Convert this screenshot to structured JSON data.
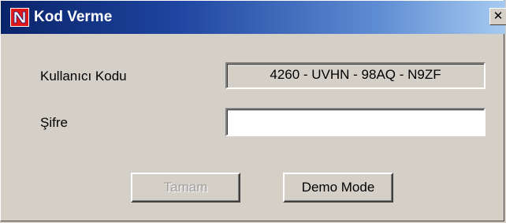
{
  "window": {
    "title": "Kod Verme",
    "close_label": "✕"
  },
  "form": {
    "user_code_label": "Kullanıcı Kodu",
    "user_code_value": "4260 - UVHN - 98AQ - N9ZF",
    "password_label": "Şifre",
    "password_value": ""
  },
  "buttons": {
    "ok_label": "Tamam",
    "ok_enabled": false,
    "demo_label": "Demo Mode"
  },
  "icons": {
    "app_icon": "app-logo-icon",
    "close_icon": "close-icon"
  },
  "colors": {
    "titlebar_start": "#0a246a",
    "titlebar_end": "#a6caf0",
    "app_icon_red": "#e01818",
    "dialog_face": "#d4d0c8"
  }
}
